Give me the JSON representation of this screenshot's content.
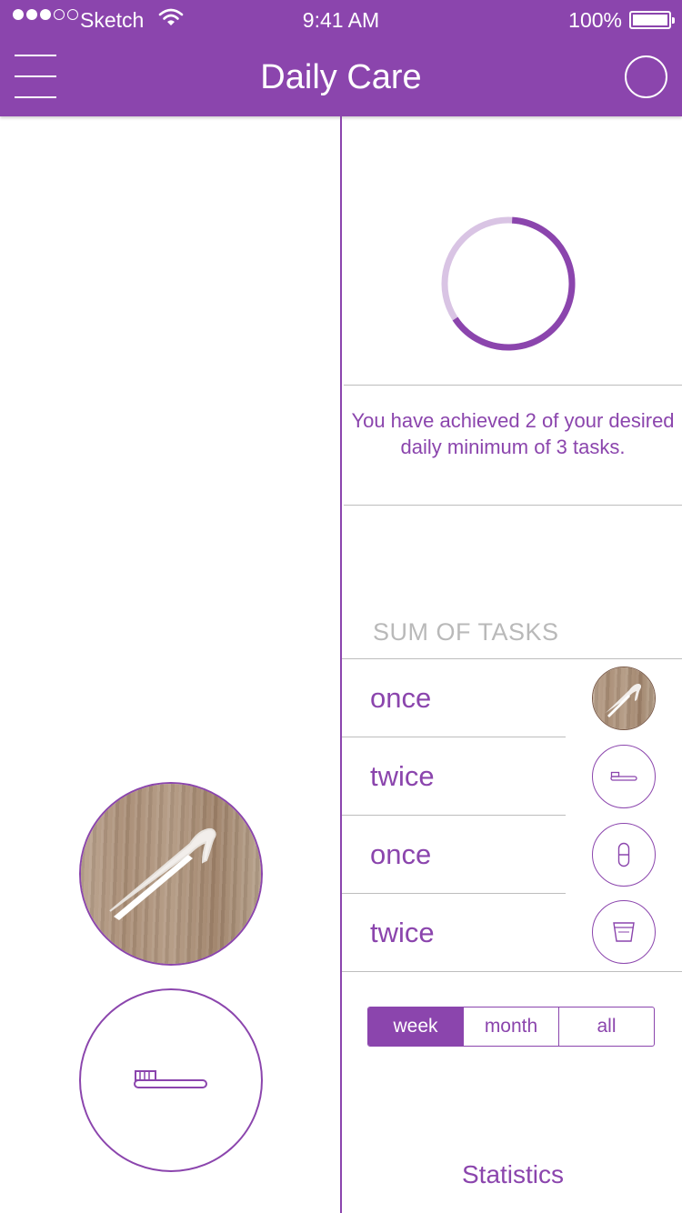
{
  "status_bar": {
    "carrier": "Sketch",
    "time": "9:41 AM",
    "battery": "100%",
    "signal_bars_filled": 3,
    "signal_bars_total": 5
  },
  "header": {
    "title": "Daily Care",
    "menu_icon": "hamburger-menu-icon",
    "sync_icon": "circle-icon"
  },
  "progress": {
    "achieved": 2,
    "minimum": 3,
    "message": "You have achieved 2 of your desired daily minimum of 3 tasks."
  },
  "tasks_section": {
    "title": "SUM OF TASKS",
    "items": [
      {
        "label": "once",
        "icon": "floss-pick-icon"
      },
      {
        "label": "twice",
        "icon": "toothbrush-icon"
      },
      {
        "label": "once",
        "icon": "pill-icon"
      },
      {
        "label": "twice",
        "icon": "rinse-cup-icon"
      }
    ]
  },
  "period_selector": {
    "options": [
      "week",
      "month",
      "all"
    ],
    "selected": "week"
  },
  "footer": {
    "label": "Statistics"
  },
  "colors": {
    "brand": "#8b45ad",
    "brand_light": "#d9c4e4",
    "divider": "#bdbdbd",
    "muted_text": "#b9b9b9"
  }
}
